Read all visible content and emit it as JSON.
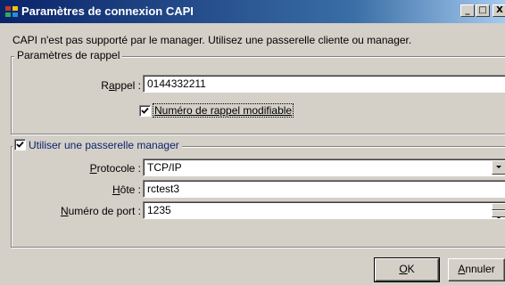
{
  "window": {
    "title": "Paramètres de connexion CAPI",
    "minimize_glyph": "_",
    "maximize_glyph": "□",
    "close_glyph": "X"
  },
  "message": "CAPI n'est pas supporté par le manager. Utilisez une passerelle cliente ou manager.",
  "callback_group": {
    "legend": "Paramètres de rappel",
    "callback_label_prefix": "R",
    "callback_label_underlined": "a",
    "callback_label_suffix": "ppel :",
    "callback_value": "0144332211",
    "modifiable_label": "Numéro de rappel modifiable",
    "modifiable_checked": true
  },
  "gateway_group": {
    "legend": "Utiliser une passerelle manager",
    "enabled": true,
    "protocol_label_underlined": "P",
    "protocol_label_suffix": "rotocole :",
    "protocol_value": "TCP/IP",
    "host_label_underlined": "H",
    "host_label_suffix": "ôte :",
    "host_value": "rctest3",
    "port_label_underlined": "N",
    "port_label_suffix": "uméro de port :",
    "port_value": "1235"
  },
  "buttons": {
    "ok_underlined": "O",
    "ok_suffix": "K",
    "cancel_underlined": "A",
    "cancel_suffix": "nnuler"
  },
  "colors": {
    "titlebar_start": "#0a246a",
    "titlebar_end": "#a6caf0",
    "face": "#d4d0c8",
    "legend_blue": "#0a246a"
  }
}
